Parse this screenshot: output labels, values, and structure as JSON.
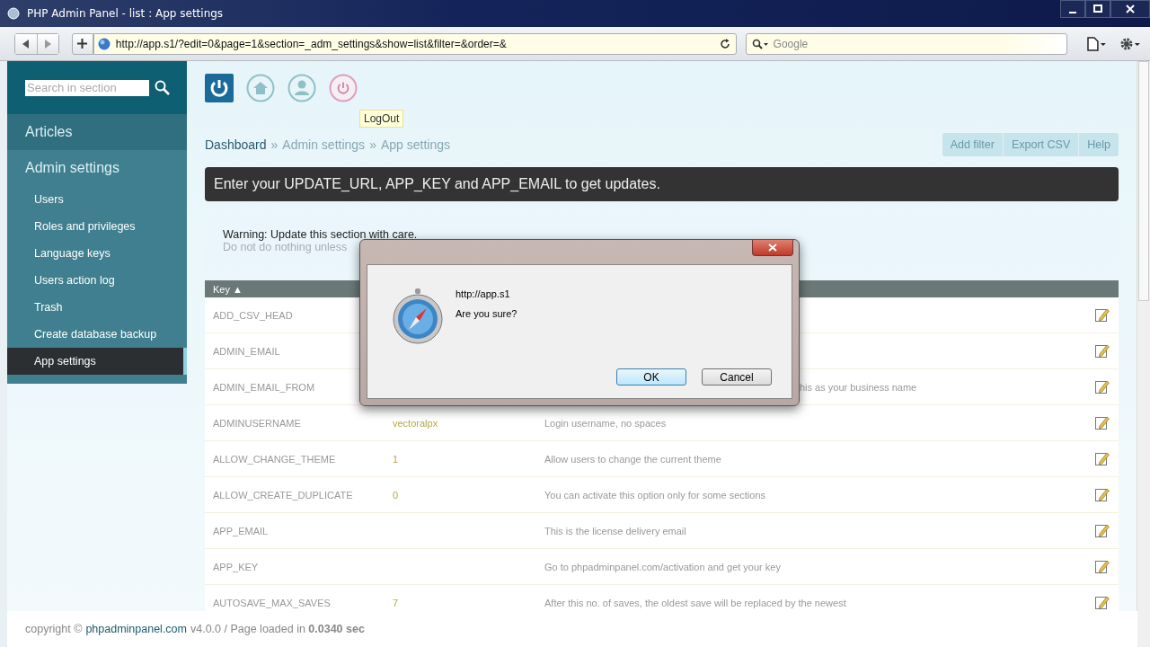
{
  "window": {
    "title": "PHP Admin Panel - list : App settings"
  },
  "browser": {
    "url": "http://app.s1/?edit=0&page=1&section=_adm_settings&show=list&filter=&order=&",
    "search_placeholder": "Google"
  },
  "sidebar": {
    "search_placeholder": "Search in section",
    "items": [
      {
        "label": "Articles",
        "kind": "section",
        "selected": false
      },
      {
        "label": "Admin settings",
        "kind": "section",
        "selected": false
      },
      {
        "label": "Users",
        "kind": "item",
        "selected": false
      },
      {
        "label": "Roles and privileges",
        "kind": "item",
        "selected": false
      },
      {
        "label": "Language keys",
        "kind": "item",
        "selected": false
      },
      {
        "label": "Users action log",
        "kind": "item",
        "selected": false
      },
      {
        "label": "Trash",
        "kind": "item",
        "selected": false
      },
      {
        "label": "Create database backup",
        "kind": "item",
        "selected": false
      },
      {
        "label": "App settings",
        "kind": "item",
        "selected": true
      }
    ]
  },
  "top_icons": [
    {
      "kind": "power",
      "selected": true
    },
    {
      "kind": "home",
      "selected": false
    },
    {
      "kind": "user",
      "selected": false
    },
    {
      "kind": "logout",
      "selected": false
    }
  ],
  "tooltip": "LogOut",
  "breadcrumb": {
    "separator": "»",
    "items": [
      "Dashboard",
      "Admin settings",
      "App settings"
    ]
  },
  "actions": [
    "Add filter",
    "Export CSV",
    "Help"
  ],
  "notice": "Enter your UPDATE_URL, APP_KEY and APP_EMAIL to get updates.",
  "warning": {
    "title": "Warning: Update this section with care.",
    "text": "Do not do nothing unless"
  },
  "table": {
    "columns": [
      "Key ▲"
    ],
    "rows": [
      {
        "key": "ADD_CSV_HEAD"
      },
      {
        "key": "ADMIN_EMAIL"
      },
      {
        "key": "ADMIN_EMAIL_FROM",
        "description": "his as your business name"
      },
      {
        "key": "ADMINUSERNAME",
        "value": "vectoralpx",
        "description": "Login username, no spaces"
      },
      {
        "key": "ALLOW_CHANGE_THEME",
        "value": "1",
        "description": "Allow users to change the current theme"
      },
      {
        "key": "ALLOW_CREATE_DUPLICATE",
        "value": "0",
        "description": "You can activate this option only for some sections"
      },
      {
        "key": "APP_EMAIL",
        "description": "This is the license delivery email"
      },
      {
        "key": "APP_KEY",
        "description": "Go to phpadminpanel.com/activation and get your key"
      },
      {
        "key": "AUTOSAVE_MAX_SAVES",
        "value": "7",
        "description": "After this no. of saves, the oldest save will be replaced by the newest"
      }
    ]
  },
  "footer": {
    "prefix": "copyright ©",
    "link": "phpadminpanel.com",
    "suffix": "v4.0.0 / Page loaded in **0.0340 sec**"
  },
  "dialog": {
    "origin": "http://app.s1",
    "message": "Are you sure?",
    "buttons": [
      {
        "label": "OK",
        "selected": true
      },
      {
        "label": "Cancel",
        "selected": false
      }
    ]
  }
}
